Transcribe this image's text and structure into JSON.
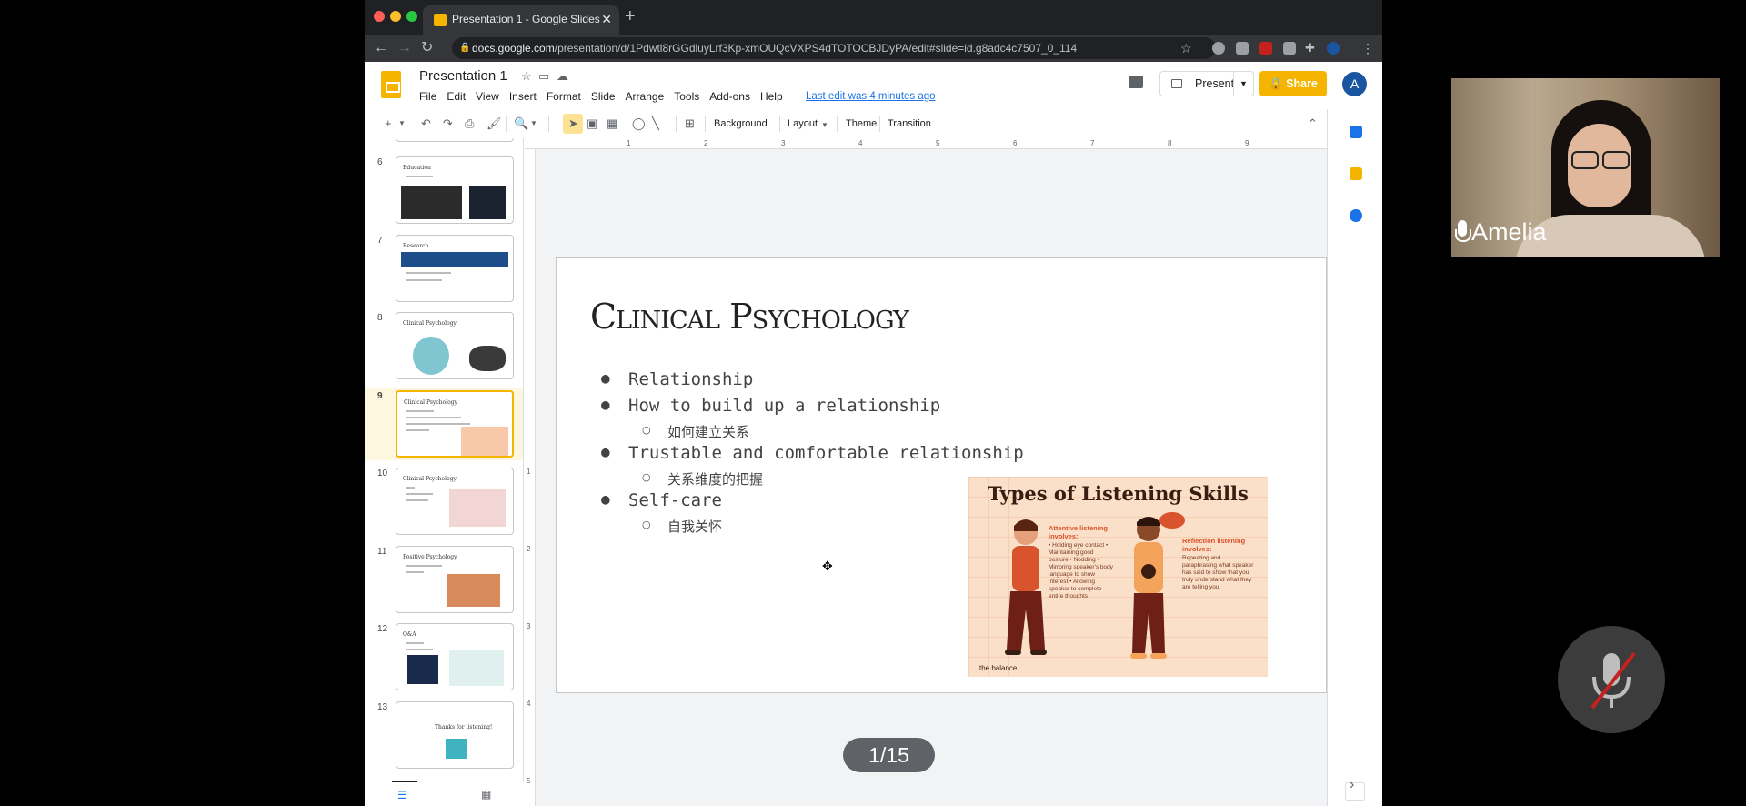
{
  "browser": {
    "tab_title": "Presentation 1 - Google Slides",
    "tab_close": "✕",
    "new_tab": "+",
    "url_host": "docs.google.com",
    "url_path": "/presentation/d/1Pdwtl8rGGdluyLrf3Kp-xmOUQcVXPS4dTOTOCBJDyPA/edit#slide=id.g8adc4c7507_0_114"
  },
  "doc": {
    "title": "Presentation 1",
    "menu": [
      "File",
      "Edit",
      "View",
      "Insert",
      "Format",
      "Slide",
      "Arrange",
      "Tools",
      "Add-ons",
      "Help"
    ],
    "last_edit": "Last edit was 4 minutes ago",
    "present_label": "Present",
    "share_label": "Share",
    "avatar_letter": "A"
  },
  "toolbar": {
    "background": "Background",
    "layout": "Layout",
    "theme": "Theme",
    "transition": "Transition"
  },
  "filmstrip": {
    "slides": [
      {
        "num": "6",
        "title": "Education"
      },
      {
        "num": "7",
        "title": "Research"
      },
      {
        "num": "8",
        "title": "Clinical Psychology"
      },
      {
        "num": "9",
        "title": "Clinical Psychology"
      },
      {
        "num": "10",
        "title": "Clinical Psychology"
      },
      {
        "num": "11",
        "title": "Positive Psychology"
      },
      {
        "num": "12",
        "title": "Q&A"
      },
      {
        "num": "13",
        "title": "Thanks for listening!"
      }
    ],
    "selected": "9"
  },
  "ruler": {
    "h": [
      "1",
      "2",
      "3",
      "4",
      "5",
      "6",
      "7",
      "8",
      "9"
    ],
    "v": [
      "1",
      "2",
      "3",
      "4",
      "5"
    ]
  },
  "slide": {
    "title": "Clinical Psychology",
    "bullets": [
      {
        "text": "Relationship"
      },
      {
        "text": "How to build up a relationship",
        "sub": "如何建立关系"
      },
      {
        "text": "Trustable and comfortable relationship",
        "sub": "关系维度的把握"
      },
      {
        "text": "Self-care",
        "sub": "自我关怀"
      }
    ],
    "image": {
      "title": "Types of Listening Skills",
      "attentive_label": "Attentive listening involves:",
      "attentive_points": "• Holding eye contact • Maintaining good posture • Nodding • Mirroring speaker's body language to show interest • Allowing speaker to complete entire thoughts",
      "reflection_label": "Reflection listening involves:",
      "reflection_text": "Repeating and paraphrasing what speaker has said to show that you truly understand what they are telling you",
      "credit": "the balance"
    }
  },
  "page_indicator": "1/15",
  "video": {
    "name": "Amelia"
  },
  "colors": {
    "accent_yellow": "#f4b400",
    "selected_slide_bg": "#fef7e0",
    "link_blue": "#1a73e8"
  }
}
